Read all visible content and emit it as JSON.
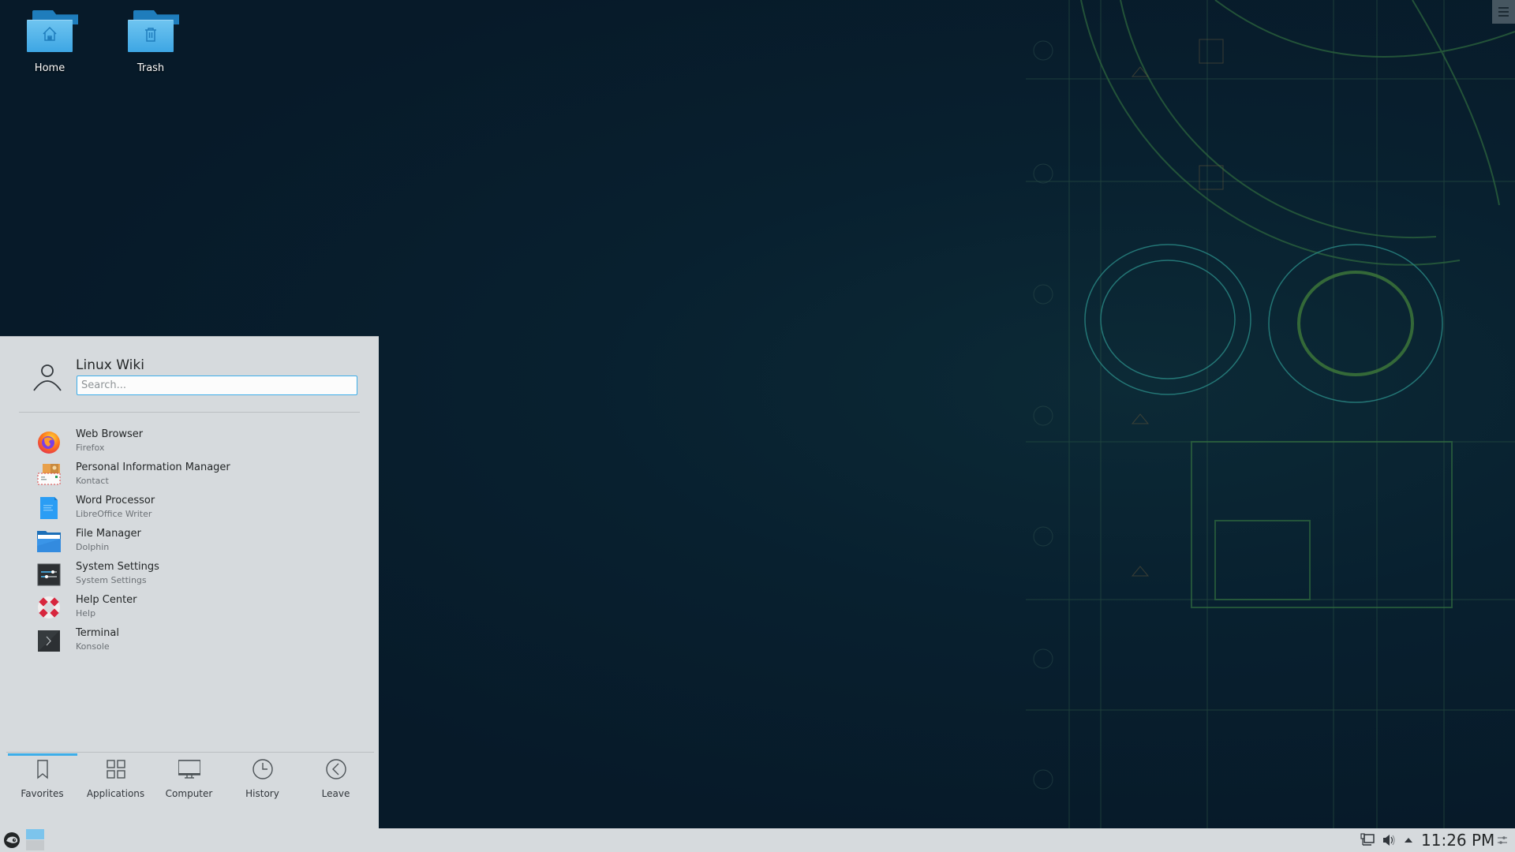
{
  "desktop": {
    "icons": [
      {
        "label": "Home",
        "icon": "home-folder-icon"
      },
      {
        "label": "Trash",
        "icon": "trash-folder-icon"
      }
    ]
  },
  "launcher": {
    "user_name": "Linux Wiki",
    "search": {
      "placeholder": "Search...",
      "value": ""
    },
    "favorites": [
      {
        "name": "Web Browser",
        "description": "Firefox",
        "icon": "firefox-icon"
      },
      {
        "name": "Personal Information Manager",
        "description": "Kontact",
        "icon": "kontact-icon"
      },
      {
        "name": "Word Processor",
        "description": "LibreOffice Writer",
        "icon": "writer-icon"
      },
      {
        "name": "File Manager",
        "description": "Dolphin",
        "icon": "dolphin-icon"
      },
      {
        "name": "System Settings",
        "description": "System Settings",
        "icon": "settings-icon"
      },
      {
        "name": "Help Center",
        "description": "Help",
        "icon": "help-icon"
      },
      {
        "name": "Terminal",
        "description": "Konsole",
        "icon": "terminal-icon"
      }
    ],
    "tabs": [
      {
        "label": "Favorites",
        "icon": "bookmark-icon",
        "active": true
      },
      {
        "label": "Applications",
        "icon": "grid-icon",
        "active": false
      },
      {
        "label": "Computer",
        "icon": "monitor-icon",
        "active": false
      },
      {
        "label": "History",
        "icon": "clock-icon",
        "active": false
      },
      {
        "label": "Leave",
        "icon": "back-arrow-icon",
        "active": false
      }
    ],
    "accent_color": "#3daee9"
  },
  "taskbar": {
    "clock": "11:26 PM",
    "tray_icons": [
      "network-icon",
      "volume-icon",
      "expand-tray-icon",
      "panel-settings-icon"
    ],
    "pager_desktops": 2,
    "active_desktop": 1
  }
}
